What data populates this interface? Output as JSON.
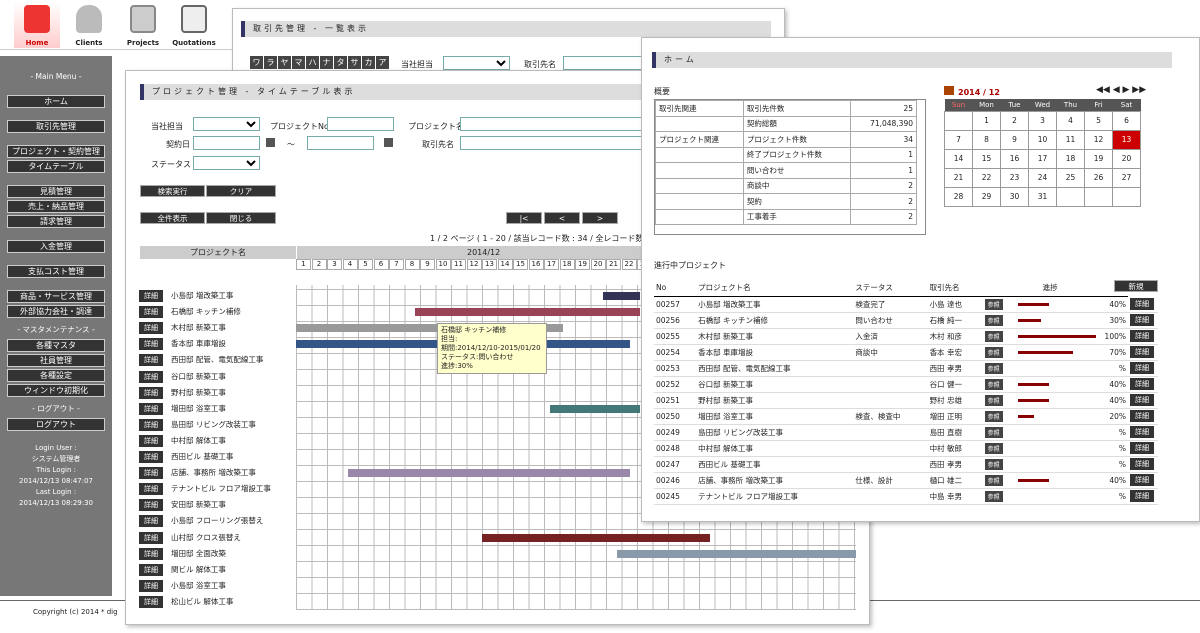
{
  "nav": [
    {
      "label": "Home",
      "icon": "home-icon"
    },
    {
      "label": "Clients",
      "icon": "user-icon"
    },
    {
      "label": "Projects",
      "icon": "folder-icon"
    },
    {
      "label": "Quotations",
      "icon": "document-icon"
    }
  ],
  "sidebar": {
    "main_menu": "- Main Menu -",
    "items": [
      "ホーム",
      "取引先管理",
      "プロジェクト・契約管理",
      "タイムテーブル",
      "見積管理",
      "売上・納品管理",
      "請求管理",
      "入金管理",
      "支払コスト管理",
      "商品・サービス管理",
      "外部協力会社・調達"
    ],
    "maint_header": "- マスタメンテナンス -",
    "maint": [
      "各種マスタ",
      "社員管理",
      "各種設定",
      "ウィンドウ初期化"
    ],
    "logout_header": "- ログアウト -",
    "logout": "ログアウト",
    "login_user_label": "Login User :",
    "login_user": "システム管理者",
    "this_login_label": "This Login :",
    "this_login": "2014/12/13 08:47:07",
    "last_login_label": "Last Login :",
    "last_login": "2014/12/13 08:29:30"
  },
  "footer": "Copyright (c) 2014 * dig",
  "client_win": {
    "title": "取引先管理 - 一覧表示",
    "kana": [
      "ワ",
      "ラ",
      "ヤ",
      "マ",
      "ハ",
      "ナ",
      "タ",
      "サ",
      "カ",
      "ア"
    ],
    "tanto_label": "当社担当",
    "name_label": "取引先名"
  },
  "project_win": {
    "title": "プロジェクト管理 - タイムテーブル表示",
    "tanto_label": "当社担当",
    "pno_label": "プロジェクトNo",
    "pname_label": "プロジェクト名",
    "contract_label": "契約日",
    "tilde": "～",
    "client_label": "取引先名",
    "status_label": "ステータス",
    "search": "検索実行",
    "clear": "クリア",
    "show_all": "全件表示",
    "close": "閉じる",
    "pager": [
      "|<",
      "<",
      ">"
    ],
    "page_info": "1 / 2 ページ ( 1 - 20 / 該当レコード数 : 34 / 全レコード数",
    "col_pname": "プロジェクト名",
    "month": "2014/12",
    "detail": "詳細",
    "rows": [
      "小島邸 増改築工事",
      "石橋邸 キッチン補修",
      "木村邸 新築工事",
      "香本邸 車庫増設",
      "西田邸 配管、電気配線工事",
      "谷口邸 新築工事",
      "野村邸 新築工事",
      "増田邸 浴室工事",
      "島田邸 リビング改装工事",
      "中村邸 解体工事",
      "西田ビル 基礎工事",
      "店舗、事務所 増改築工事",
      "テナントビル フロア増設工事",
      "安田邸 新築工事",
      "小島邸 フローリング張替え",
      "山村邸 クロス張替え",
      "増田邸 全面改築",
      "関ビル 解体工事",
      "小島邸 浴室工事",
      "松山ビル 解体工事"
    ],
    "tooltip": [
      "石橋邸 キッチン補修",
      "担当:",
      "期間:2014/12/10-2015/01/20",
      "ステータス:問い合わせ",
      "進捗:30%"
    ]
  },
  "home_win": {
    "title": "ホーム",
    "summary_title": "概要",
    "summary": [
      [
        "取引先関連",
        "取引先件数",
        "25"
      ],
      [
        "",
        "契約総額",
        "71,048,390"
      ],
      [
        "プロジェクト関連",
        "プロジェクト件数",
        "34"
      ],
      [
        "",
        "終了プロジェクト件数",
        "1"
      ],
      [
        "",
        "問い合わせ",
        "1"
      ],
      [
        "",
        "商談中",
        "2"
      ],
      [
        "",
        "契約",
        "2"
      ],
      [
        "",
        "工事着手",
        "2"
      ]
    ],
    "calendar": {
      "title": "2014 / 12",
      "days": [
        "Sun",
        "Mon",
        "Tue",
        "Wed",
        "Thu",
        "Fri",
        "Sat"
      ],
      "weeks": [
        [
          "",
          "1",
          "2",
          "3",
          "4",
          "5",
          "6"
        ],
        [
          "7",
          "8",
          "9",
          "10",
          "11",
          "12",
          "13"
        ],
        [
          "14",
          "15",
          "16",
          "17",
          "18",
          "19",
          "20"
        ],
        [
          "21",
          "22",
          "23",
          "24",
          "25",
          "26",
          "27"
        ],
        [
          "28",
          "29",
          "30",
          "31",
          "",
          "",
          ""
        ]
      ],
      "today": "13"
    },
    "active_title": "進行中プロジェクト",
    "new_btn": "新規",
    "cols": [
      "No",
      "プロジェクト名",
      "ステータス",
      "取引先名",
      "進捗"
    ],
    "rows": [
      [
        "00257",
        "小島邸 増改築工事",
        "検査完了",
        "小島 達也",
        "40%"
      ],
      [
        "00256",
        "石橋邸 キッチン補修",
        "問い合わせ",
        "石橋 純一",
        "30%"
      ],
      [
        "00255",
        "木村邸 新築工事",
        "入金済",
        "木村 和彦",
        "100%"
      ],
      [
        "00254",
        "香本邸 車庫増設",
        "商談中",
        "香本 幸宏",
        "70%"
      ],
      [
        "00253",
        "西田邸 配管、電気配線工事",
        "",
        "西田 孝男",
        "%"
      ],
      [
        "00252",
        "谷口邸 新築工事",
        "",
        "谷口 健一",
        "40%"
      ],
      [
        "00251",
        "野村邸 新築工事",
        "",
        "野村 忠雄",
        "40%"
      ],
      [
        "00250",
        "増田邸 浴室工事",
        "検査、検査中",
        "増田 正明",
        "20%"
      ],
      [
        "00249",
        "島田邸 リビング改装工事",
        "",
        "島田 直樹",
        "%"
      ],
      [
        "00248",
        "中村邸 解体工事",
        "",
        "中村 敏郎",
        "%"
      ],
      [
        "00247",
        "西田ビル 基礎工事",
        "",
        "西田 孝男",
        "%"
      ],
      [
        "00246",
        "店舗、事務所 増改築工事",
        "仕様、設計",
        "樋口 雄二",
        "40%"
      ],
      [
        "00245",
        "テナントビル フロア増設工事",
        "",
        "中島 幸男",
        "%"
      ]
    ],
    "ref": "参照",
    "detail": "詳細"
  },
  "colors": {
    "accent": "#336",
    "today": "#c00",
    "bar": "#800"
  }
}
